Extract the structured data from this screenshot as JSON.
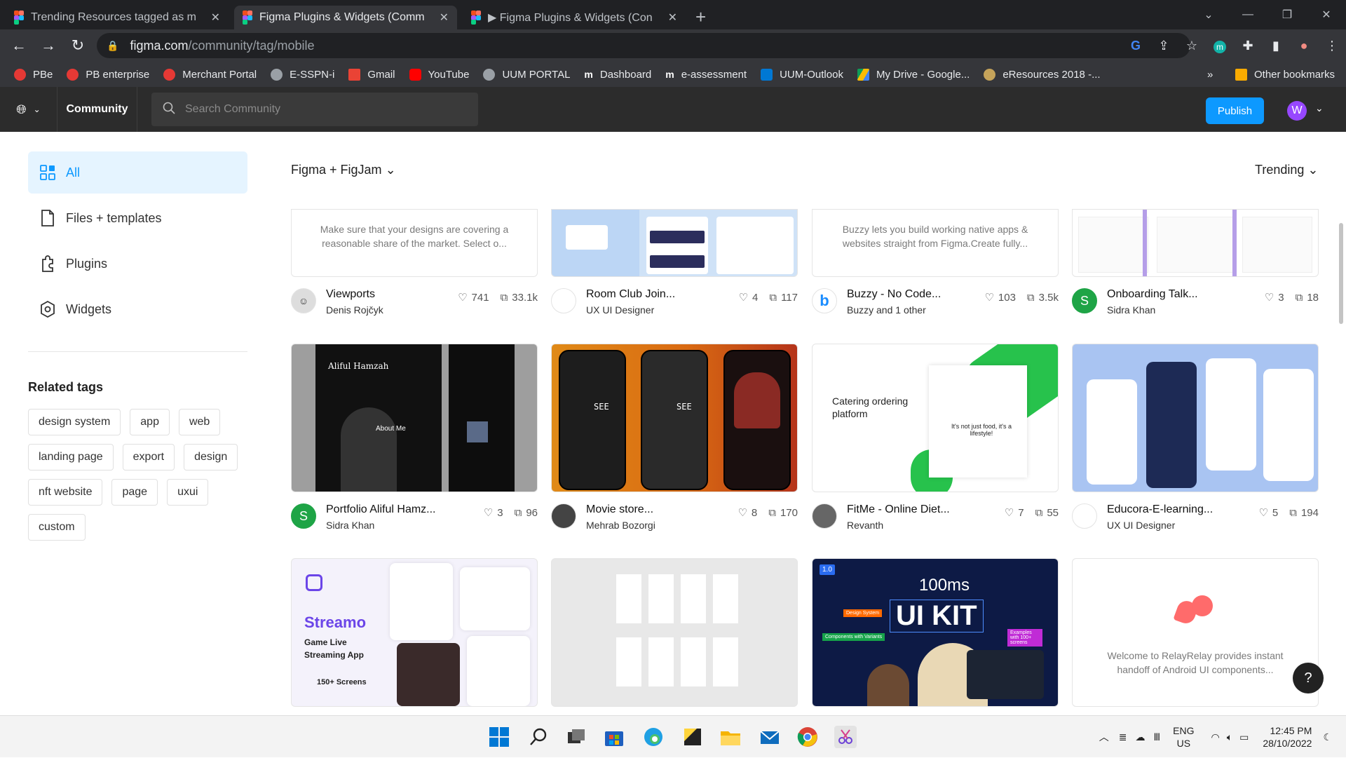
{
  "browser": {
    "tabs": [
      {
        "title": "Trending Resources tagged as m",
        "active": false
      },
      {
        "title": "Figma Plugins & Widgets (Comm",
        "active": true
      },
      {
        "title": "▶ Figma Plugins & Widgets (Con",
        "active": false
      }
    ],
    "url_host": "figma.com",
    "url_path": "/community/tag/mobile",
    "bookmarks": [
      "PBe",
      "PB enterprise",
      "Merchant Portal",
      "E-SSPN-i",
      "Gmail",
      "YouTube",
      "UUM PORTAL",
      "Dashboard",
      "e-assessment",
      "UUM-Outlook",
      "My Drive - Google...",
      "eResources 2018 -..."
    ],
    "bookmarks_more": "»",
    "other_bookmarks": "Other bookmarks"
  },
  "header": {
    "community_label": "Community",
    "search_placeholder": "Search Community",
    "publish_label": "Publish",
    "avatar_letter": "W"
  },
  "sidebar": {
    "nav": [
      {
        "label": "All",
        "icon": "grid-icon",
        "active": true
      },
      {
        "label": "Files + templates",
        "icon": "file-icon",
        "active": false
      },
      {
        "label": "Plugins",
        "icon": "plugin-icon",
        "active": false
      },
      {
        "label": "Widgets",
        "icon": "widget-icon",
        "active": false
      }
    ],
    "related_title": "Related tags",
    "tags": [
      "design system",
      "app",
      "web",
      "landing page",
      "export",
      "design",
      "nft website",
      "page",
      "uxui",
      "custom"
    ]
  },
  "main": {
    "filter_label": "Figma + FigJam",
    "sort_label": "Trending",
    "cards": [
      {
        "title": "Viewports",
        "author": "Denis Rojčyk",
        "likes": "741",
        "uses": "33.1k",
        "desc": "Make sure that your designs are covering a reasonable share of the market. Select o..."
      },
      {
        "title": "Room Club Join...",
        "author": "UX UI Designer",
        "likes": "4",
        "uses": "117"
      },
      {
        "title": "Buzzy - No Code...",
        "author": "Buzzy and 1 other",
        "likes": "103",
        "uses": "3.5k",
        "desc": "Buzzy lets you build working native apps & websites straight from Figma.Create fully..."
      },
      {
        "title": "Onboarding Talk...",
        "author": "Sidra Khan",
        "likes": "3",
        "uses": "18",
        "avatar_letter": "S"
      },
      {
        "title": "Portfolio Aliful Hamz...",
        "author": "Sidra Khan",
        "likes": "3",
        "uses": "96",
        "avatar_letter": "S",
        "thumb_name": "Aliful Hamzah",
        "thumb_sub": "About Me"
      },
      {
        "title": "Movie store...",
        "author": "Mehrab Bozorgi",
        "likes": "8",
        "uses": "170",
        "thumb_text": "SEE"
      },
      {
        "title": "FitMe - Online Diet...",
        "author": "Revanth",
        "likes": "7",
        "uses": "55",
        "thumb_title": "Catering ordering platform",
        "thumb_tagline": "It's not just food, it's a lifestyle!"
      },
      {
        "title": "Educora-E-learning...",
        "author": "UX UI Designer",
        "likes": "5",
        "uses": "194"
      },
      {
        "title": "",
        "thumb_brand": "Streamo",
        "thumb_sub": "Game Live Streaming App",
        "thumb_count": "150+ Screens"
      },
      {
        "title": ""
      },
      {
        "title": "",
        "thumb_version": "1.0",
        "thumb_brand": "100ms",
        "thumb_big": "UI KIT",
        "thumb_tag1": "Design System",
        "thumb_tag2": "Components with Variants",
        "thumb_tag3": "Examples with 100+ screens"
      },
      {
        "title": "",
        "desc": "Welcome to RelayRelay provides instant handoff of Android UI components..."
      }
    ]
  },
  "help_label": "?",
  "taskbar": {
    "lang_top": "ENG",
    "lang_bottom": "US",
    "time": "12:45 PM",
    "date": "28/10/2022"
  },
  "colors": {
    "accent": "#0d99ff",
    "header_bg": "#2c2c2c",
    "chrome_bg": "#35363a"
  }
}
